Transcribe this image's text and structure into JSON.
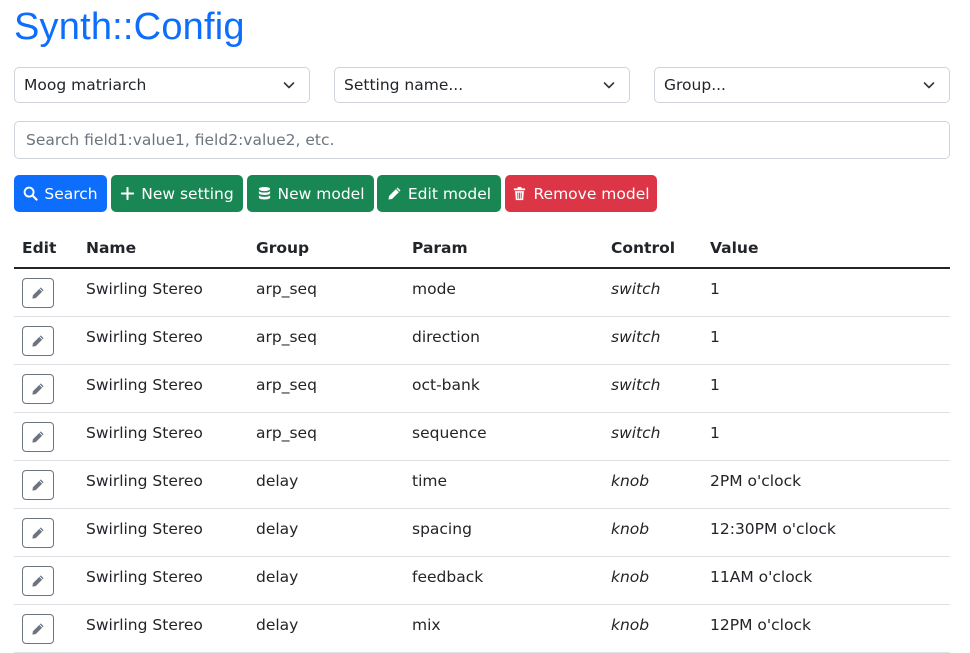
{
  "app": {
    "title": "Synth::Config"
  },
  "filters": {
    "model": {
      "value": "Moog matriarch",
      "icon": "chevron-down-icon"
    },
    "setting": {
      "value": "Setting name...",
      "icon": "chevron-down-icon"
    },
    "group": {
      "value": "Group...",
      "icon": "chevron-down-icon"
    }
  },
  "search": {
    "placeholder": "Search field1:value1, field2:value2, etc."
  },
  "toolbar": {
    "search_label": "Search",
    "new_setting_label": "New setting",
    "new_model_label": "New model",
    "edit_model_label": "Edit model",
    "remove_model_label": "Remove model"
  },
  "colors": {
    "primary": "#0d6efd",
    "success": "#198754",
    "danger": "#dc3545"
  },
  "table": {
    "headers": {
      "edit": "Edit",
      "name": "Name",
      "group": "Group",
      "param": "Param",
      "control": "Control",
      "value": "Value"
    },
    "rows": [
      {
        "name": "Swirling Stereo",
        "group": "arp_seq",
        "param": "mode",
        "control": "switch",
        "value": "1"
      },
      {
        "name": "Swirling Stereo",
        "group": "arp_seq",
        "param": "direction",
        "control": "switch",
        "value": "1"
      },
      {
        "name": "Swirling Stereo",
        "group": "arp_seq",
        "param": "oct-bank",
        "control": "switch",
        "value": "1"
      },
      {
        "name": "Swirling Stereo",
        "group": "arp_seq",
        "param": "sequence",
        "control": "switch",
        "value": "1"
      },
      {
        "name": "Swirling Stereo",
        "group": "delay",
        "param": "time",
        "control": "knob",
        "value": "2PM o'clock"
      },
      {
        "name": "Swirling Stereo",
        "group": "delay",
        "param": "spacing",
        "control": "knob",
        "value": "12:30PM o'clock"
      },
      {
        "name": "Swirling Stereo",
        "group": "delay",
        "param": "feedback",
        "control": "knob",
        "value": "11AM o'clock"
      },
      {
        "name": "Swirling Stereo",
        "group": "delay",
        "param": "mix",
        "control": "knob",
        "value": "12PM o'clock"
      }
    ]
  }
}
